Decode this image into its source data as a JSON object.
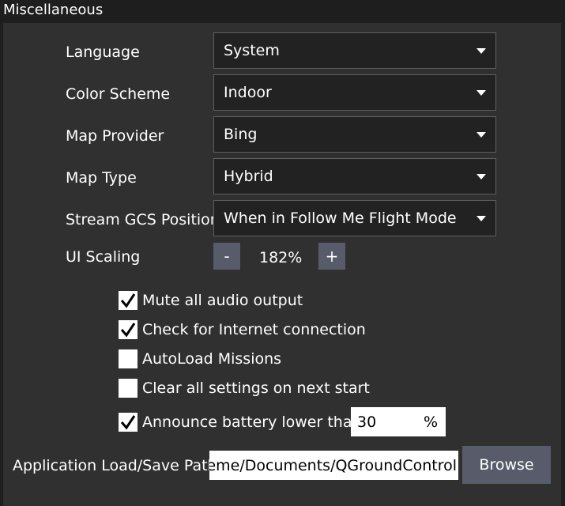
{
  "section": {
    "title": "Miscellaneous"
  },
  "settings": [
    {
      "label": "Language",
      "value": "System"
    },
    {
      "label": "Color Scheme",
      "value": "Indoor"
    },
    {
      "label": "Map Provider",
      "value": "Bing"
    },
    {
      "label": "Map Type",
      "value": "Hybrid"
    },
    {
      "label": "Stream GCS Position",
      "value": "When in Follow Me Flight Mode"
    }
  ],
  "ui_scaling": {
    "label": "UI Scaling",
    "minus": "-",
    "value": "182%",
    "plus": "+"
  },
  "checkboxes": [
    {
      "label": "Mute all audio output",
      "checked": true
    },
    {
      "label": "Check for Internet connection",
      "checked": true
    },
    {
      "label": "AutoLoad Missions",
      "checked": false
    },
    {
      "label": "Clear all settings on next start",
      "checked": false
    },
    {
      "label": "Announce battery lower than",
      "checked": true
    }
  ],
  "battery": {
    "value": "30",
    "unit": "%"
  },
  "path": {
    "label": "Application Load/Save Path",
    "value": "kleme/Documents/QGroundControl",
    "browse_label": "Browse"
  }
}
